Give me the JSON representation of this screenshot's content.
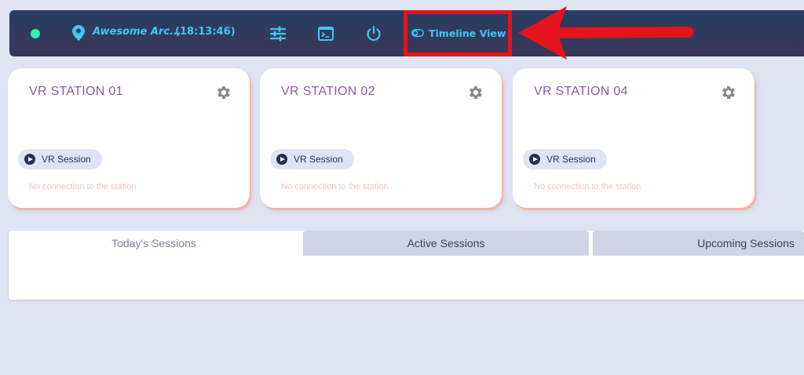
{
  "topbar": {
    "location": "Awesome Arc...",
    "clock": "(18:13:46)",
    "timeline_label": "Timeline View",
    "colors": {
      "accent": "#41c8f0",
      "online": "#34f0b0",
      "highlight": "#e3141c"
    },
    "icons": [
      "status-dot-icon",
      "location-pin-icon",
      "sliders-icon",
      "terminal-icon",
      "power-icon",
      "toggle-icon"
    ]
  },
  "stations": [
    {
      "title": "VR STATION 01",
      "session_label": "VR Session",
      "status": "No connection to the station"
    },
    {
      "title": "VR STATION 02",
      "session_label": "VR Session",
      "status": "No connection to the station"
    },
    {
      "title": "VR STATION 04",
      "session_label": "VR Session",
      "status": "No connection to the station"
    }
  ],
  "tabs": [
    {
      "label": "Today's Sessions",
      "active": true
    },
    {
      "label": "Active Sessions",
      "active": false
    },
    {
      "label": "Upcoming Sessions",
      "active": false
    }
  ]
}
